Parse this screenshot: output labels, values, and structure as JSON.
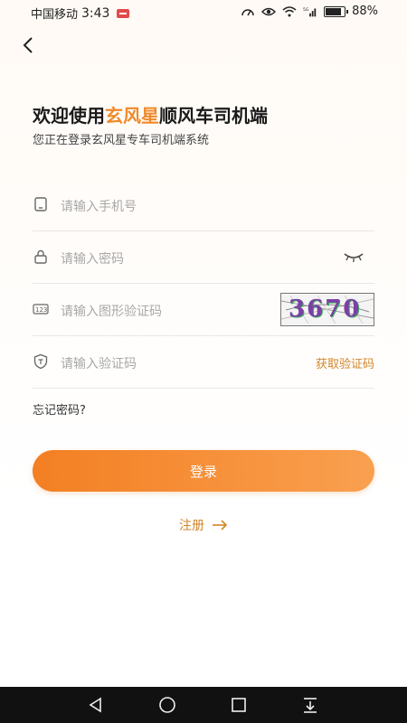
{
  "status_bar": {
    "carrier": "中国移动",
    "time": "3:43",
    "battery": "88%",
    "icons": [
      "speed-icon",
      "eye-icon",
      "wifi-icon",
      "5g-signal-icon",
      "battery-icon"
    ]
  },
  "header": {
    "back_icon": "chevron-left-icon"
  },
  "welcome": {
    "prefix": "欢迎使用",
    "highlight": "玄风星",
    "suffix": "顺风车司机端",
    "subtitle": "您正在登录玄风星专车司机端系统"
  },
  "form": {
    "phone_placeholder": "请输入手机号",
    "password_placeholder": "请输入密码",
    "captcha_placeholder": "请输入图形验证码",
    "captcha_text": "3670",
    "sms_placeholder": "请输入验证码",
    "get_code_label": "获取验证码",
    "forgot_label": "忘记密码?",
    "login_label": "登录",
    "register_label": "注册"
  },
  "colors": {
    "accent": "#f08a2a",
    "link": "#d1862a"
  },
  "nav": {
    "icons": [
      "back-triangle-icon",
      "home-circle-icon",
      "recent-square-icon",
      "notification-pull-icon"
    ]
  }
}
